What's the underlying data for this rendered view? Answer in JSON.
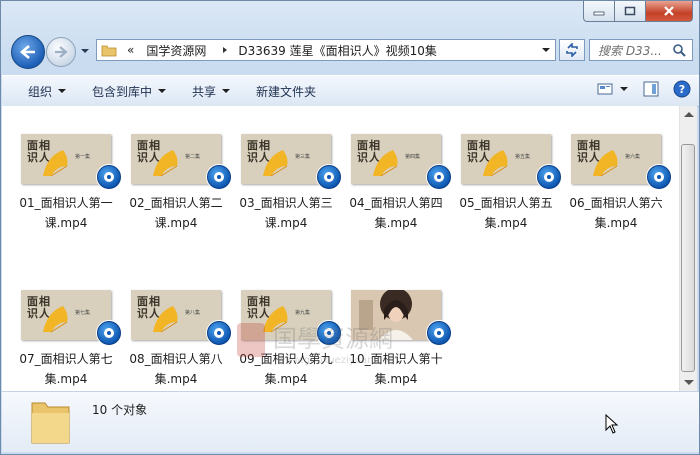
{
  "addressbar": {
    "overflow": "«",
    "crumbs": [
      "国学资源网",
      "D33639 莲星《面相识人》视频10集"
    ]
  },
  "search": {
    "placeholder": "搜索 D33..."
  },
  "commandbar": {
    "organize": "组织",
    "include_library": "包含到库中",
    "share": "共享",
    "new_folder": "新建文件夹"
  },
  "thumb_text": {
    "line1": "面相",
    "line2": "识人"
  },
  "files": [
    {
      "name": "01_面相识人第一课.mp4",
      "line1": "01_面相识人第一",
      "line2": "课.mp4",
      "episode": "第一集",
      "type": "graphic"
    },
    {
      "name": "02_面相识人第二课.mp4",
      "line1": "02_面相识人第二",
      "line2": "课.mp4",
      "episode": "第二集",
      "type": "graphic"
    },
    {
      "name": "03_面相识人第三课.mp4",
      "line1": "03_面相识人第三",
      "line2": "课.mp4",
      "episode": "第三集",
      "type": "graphic"
    },
    {
      "name": "04_面相识人第四集.mp4",
      "line1": "04_面相识人第四",
      "line2": "集.mp4",
      "episode": "第四集",
      "type": "graphic"
    },
    {
      "name": "05_面相识人第五集.mp4",
      "line1": "05_面相识人第五",
      "line2": "集.mp4",
      "episode": "第五集",
      "type": "graphic"
    },
    {
      "name": "06_面相识人第六集.mp4",
      "line1": "06_面相识人第六",
      "line2": "集.mp4",
      "episode": "第六集",
      "type": "graphic"
    },
    {
      "name": "07_面相识人第七集.mp4",
      "line1": "07_面相识人第七",
      "line2": "集.mp4",
      "episode": "第七集",
      "type": "graphic"
    },
    {
      "name": "08_面相识人第八集.mp4",
      "line1": "08_面相识人第八",
      "line2": "集.mp4",
      "episode": "第八集",
      "type": "graphic"
    },
    {
      "name": "09_面相识人第九集.mp4",
      "line1": "09_面相识人第九",
      "line2": "集.mp4",
      "episode": "第九集",
      "type": "graphic"
    },
    {
      "name": "10_面相识人第十集.mp4",
      "line1": "10_面相识人第十",
      "line2": "集.mp4",
      "episode": "",
      "type": "photo"
    }
  ],
  "watermark": {
    "title": "国學資源網",
    "url": "www.guoxueziyuan.com"
  },
  "status": {
    "count": "10 个对象"
  },
  "colors": {
    "window_frame": "#c9dcf0",
    "thumb_bg": "#d8d0bd",
    "badge_blue": "#0d56b0",
    "close_red": "#c44128"
  }
}
